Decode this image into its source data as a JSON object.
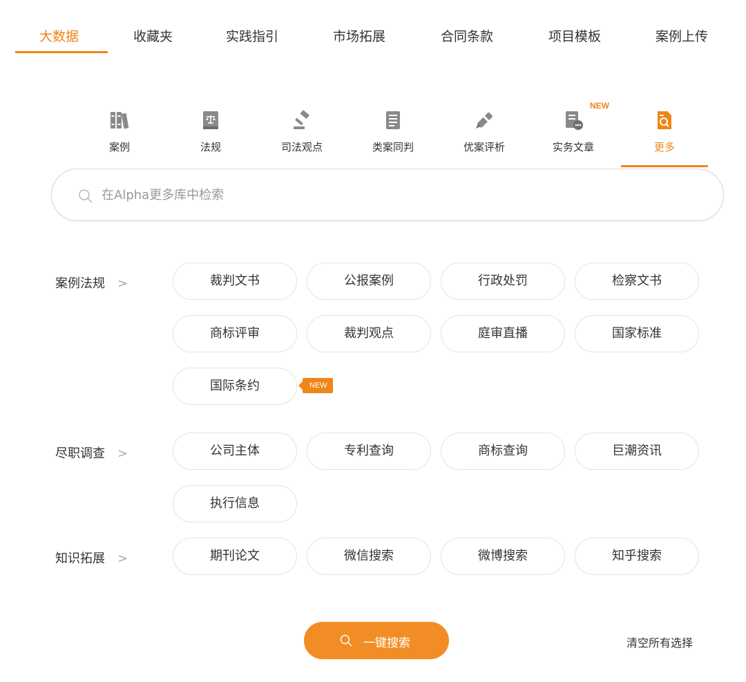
{
  "colors": {
    "accent": "#f08519",
    "icon": "#8a8a8a",
    "border": "#e3e3e3"
  },
  "top_tabs": [
    {
      "label": "大数据",
      "active": true
    },
    {
      "label": "收藏夹"
    },
    {
      "label": "实践指引"
    },
    {
      "label": "市场拓展"
    },
    {
      "label": "合同条款"
    },
    {
      "label": "项目模板"
    },
    {
      "label": "案例上传"
    }
  ],
  "categories": [
    {
      "label": "案例",
      "icon": "books-icon"
    },
    {
      "label": "法规",
      "icon": "law-book-icon"
    },
    {
      "label": "司法观点",
      "icon": "gavel-icon"
    },
    {
      "label": "类案同判",
      "icon": "document-icon"
    },
    {
      "label": "优案评析",
      "icon": "pen-icon"
    },
    {
      "label": "实务文章",
      "icon": "article-chat-icon",
      "badge": "NEW"
    },
    {
      "label": "更多",
      "icon": "file-search-icon",
      "active": true
    }
  ],
  "search": {
    "placeholder": "在Alpha更多库中检索",
    "value": ""
  },
  "groups": [
    {
      "label": "案例法规",
      "items": [
        "裁判文书",
        "公报案例",
        "行政处罚",
        "检察文书",
        "商标评审",
        "裁判观点",
        "庭审直播",
        "国家标准",
        "国际条约"
      ],
      "new_badge": "NEW"
    },
    {
      "label": "尽职调查",
      "items": [
        "公司主体",
        "专利查询",
        "商标查询",
        "巨潮资讯",
        "执行信息"
      ]
    },
    {
      "label": "知识拓展",
      "items": [
        "期刊论文",
        "微信搜索",
        "微博搜索",
        "知乎搜索"
      ]
    }
  ],
  "actions": {
    "search_label": "一键搜索",
    "clear_label": "清空所有选择"
  }
}
